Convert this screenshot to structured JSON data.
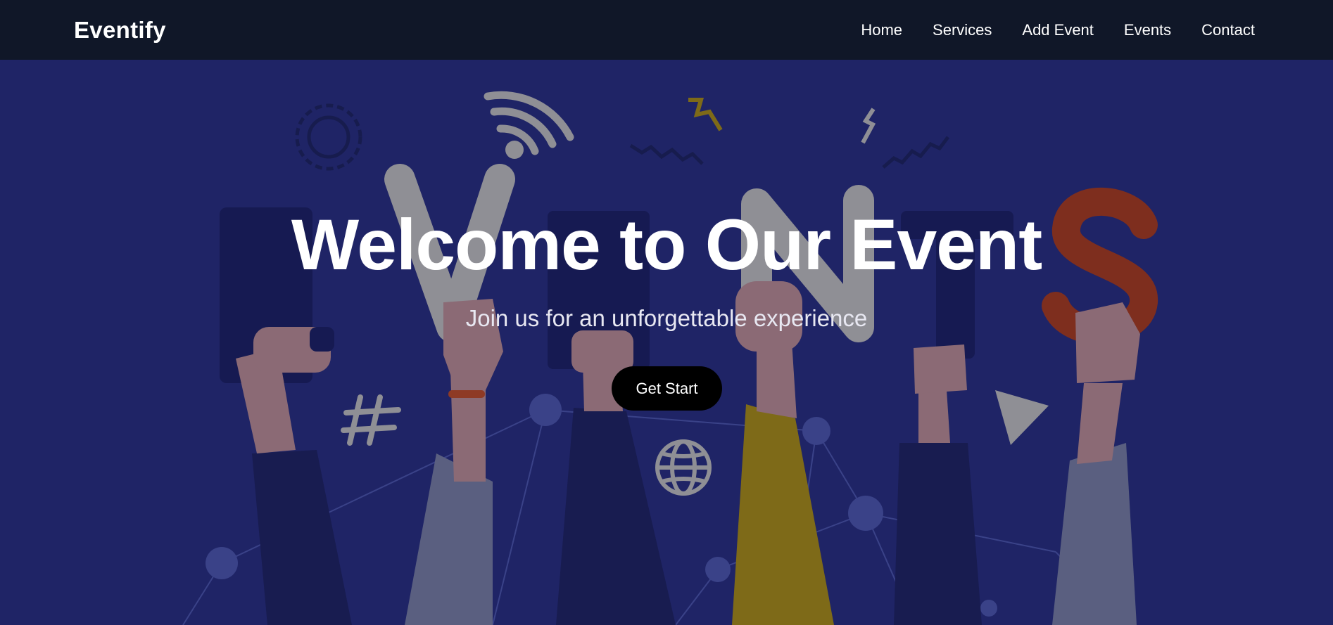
{
  "brand": "Eventify",
  "nav": {
    "items": [
      {
        "label": "Home"
      },
      {
        "label": "Services"
      },
      {
        "label": "Add Event"
      },
      {
        "label": "Events"
      },
      {
        "label": "Contact"
      }
    ]
  },
  "hero": {
    "title": "Welcome to Our Event",
    "subtitle": "Join us for an unforgettable experience",
    "cta_label": "Get Start",
    "background_letters": "EVENTS"
  },
  "colors": {
    "navbar": "#101728",
    "hero_overlay": "#1f2466",
    "button": "#000000",
    "text": "#ffffff",
    "letter_s_accent": "#7e2e1e",
    "yellow_sleeve": "#7e6a18"
  },
  "icons": [
    "gear-icon",
    "wifi-icon",
    "hashtag-icon",
    "globe-icon",
    "play-triangle-icon",
    "zigzag-icon"
  ]
}
